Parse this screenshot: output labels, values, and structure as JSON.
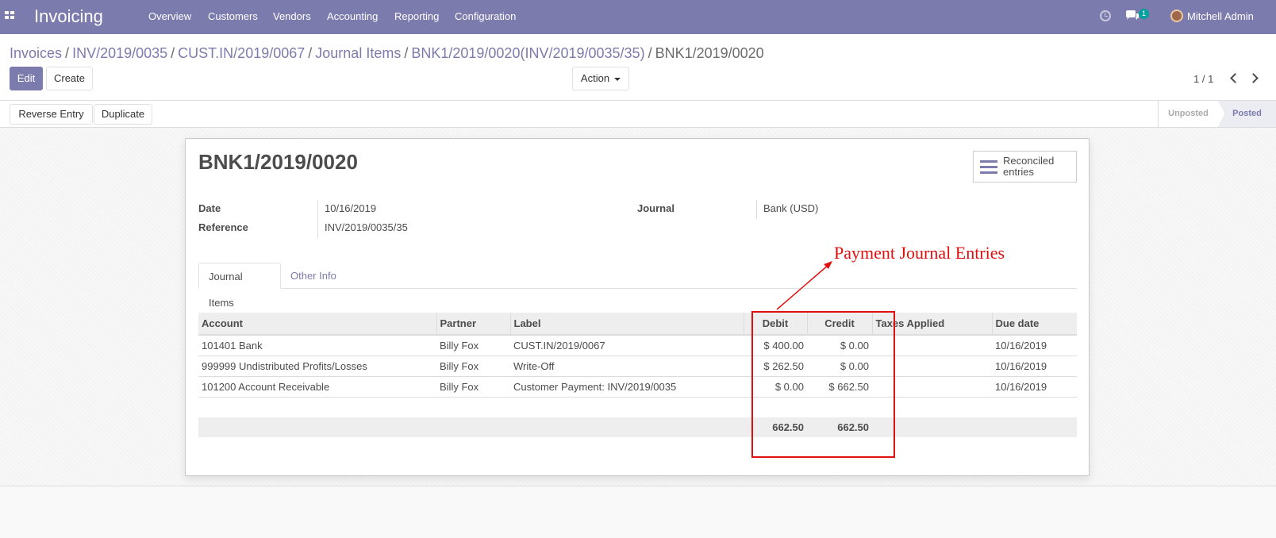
{
  "navbar": {
    "app_title": "Invoicing",
    "menu": [
      "Overview",
      "Customers",
      "Vendors",
      "Accounting",
      "Reporting",
      "Configuration"
    ],
    "chat_badge": "1",
    "user_name": "Mitchell Admin",
    "bg_color": "#7c7bad"
  },
  "breadcrumb": {
    "items": [
      "Invoices",
      "INV/2019/0035",
      "CUST.IN/2019/0067",
      "Journal Items",
      "BNK1/2019/0020(INV/2019/0035/35)"
    ],
    "current": "BNK1/2019/0020"
  },
  "buttons": {
    "edit": "Edit",
    "create": "Create",
    "action": "Action",
    "reverse_entry": "Reverse Entry",
    "duplicate": "Duplicate"
  },
  "pager": {
    "value": "1 / 1"
  },
  "status": {
    "unposted": "Unposted",
    "posted": "Posted",
    "active": "Posted"
  },
  "record": {
    "title": "BNK1/2019/0020",
    "smart_button": {
      "line1": "Reconciled",
      "line2": "entries"
    },
    "date_label": "Date",
    "date_value": "10/16/2019",
    "reference_label": "Reference",
    "reference_value": "INV/2019/0035/35",
    "journal_label": "Journal",
    "journal_value": "Bank (USD)"
  },
  "tabs": [
    "Journal Items",
    "Other Info"
  ],
  "table": {
    "headers": [
      "Account",
      "Partner",
      "Label",
      "Debit",
      "Credit",
      "Taxes Applied",
      "Due date"
    ],
    "rows": [
      [
        "101401 Bank",
        "Billy Fox",
        "CUST.IN/2019/0067",
        "$ 400.00",
        "$ 0.00",
        "",
        "10/16/2019"
      ],
      [
        "999999 Undistributed Profits/Losses",
        "Billy Fox",
        "Write-Off",
        "$ 262.50",
        "$ 0.00",
        "",
        "10/16/2019"
      ],
      [
        "101200 Account Receivable",
        "Billy Fox",
        "Customer Payment: INV/2019/0035",
        "$ 0.00",
        "$ 662.50",
        "",
        "10/16/2019"
      ]
    ],
    "total_debit": "662.50",
    "total_credit": "662.50"
  },
  "annotation": {
    "text": "Payment Journal Entries",
    "color": "#e01010"
  }
}
